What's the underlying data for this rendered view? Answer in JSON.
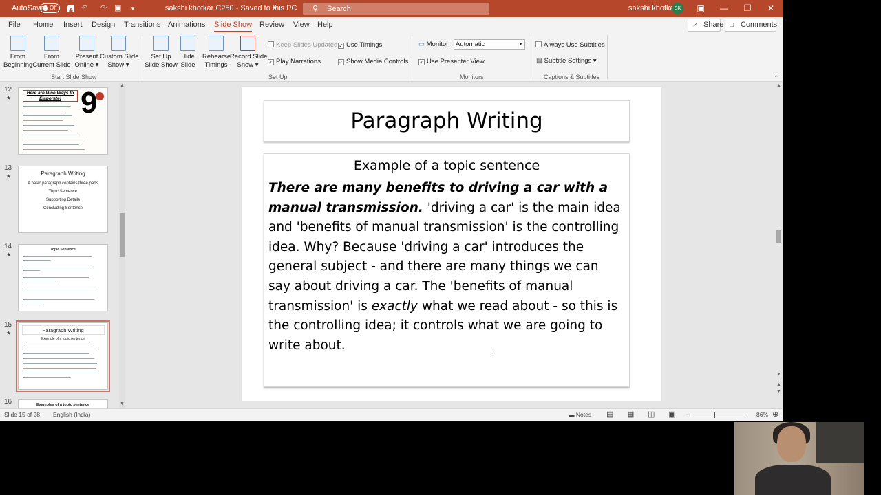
{
  "titlebar": {
    "autosave_label": "AutoSave",
    "autosave_state": "Off",
    "document_title": "sakshi khotkar C250  -  Saved to this PC",
    "search_placeholder": "Search",
    "user_name": "sakshi khotkar",
    "user_initials": "SK"
  },
  "tabs": [
    "File",
    "Home",
    "Insert",
    "Design",
    "Transitions",
    "Animations",
    "Slide Show",
    "Review",
    "View",
    "Help"
  ],
  "active_tab": "Slide Show",
  "share_label": "Share",
  "comments_label": "Comments",
  "ribbon": {
    "from_beginning": [
      "From",
      "Beginning"
    ],
    "from_current": [
      "From",
      "Current Slide"
    ],
    "present_online": [
      "Present",
      "Online"
    ],
    "custom_show": [
      "Custom Slide",
      "Show"
    ],
    "group_start": "Start Slide Show",
    "setup_show": [
      "Set Up",
      "Slide Show"
    ],
    "hide_slide": [
      "Hide",
      "Slide"
    ],
    "rehearse": [
      "Rehearse",
      "Timings"
    ],
    "record": [
      "Record Slide",
      "Show"
    ],
    "keep_slides_updated": "Keep Slides Updated",
    "use_timings": "Use Timings",
    "play_narrations": "Play Narrations",
    "show_media_controls": "Show Media Controls",
    "group_setup": "Set Up",
    "monitor_label": "Monitor:",
    "monitor_value": "Automatic",
    "use_presenter_view": "Use Presenter View",
    "group_monitors": "Monitors",
    "always_use_subtitles": "Always Use Subtitles",
    "subtitle_settings": "Subtitle Settings",
    "group_captions": "Captions & Subtitles"
  },
  "thumbnails": [
    {
      "num": "12",
      "title": "Here are Nine Ways to Elaborate!",
      "big": "9"
    },
    {
      "num": "13",
      "title": "Paragraph Writing",
      "lines": [
        "A basic paragraph contains three parts",
        "Topic Sentence",
        "Supporting Details",
        "Concluding Sentence"
      ]
    },
    {
      "num": "14",
      "title": "Topic Sentence"
    },
    {
      "num": "15",
      "title": "Paragraph Writing",
      "sub": "Example of a topic sentence"
    },
    {
      "num": "16",
      "title": "Examples of a topic sentence"
    }
  ],
  "slide": {
    "title": "Paragraph Writing",
    "heading": "Example of a topic sentence",
    "bold_italic": "There are many benefits to driving a car with a manual transmission.",
    "text_1": "  'driving a car' is the main idea and 'benefits of manual transmission' is the controlling idea. Why? Because 'driving a car' introduces the general subject - and there are many things we can say about driving a car. The 'benefits of manual transmission' is ",
    "italic_word": "exactly",
    "text_2": " what we read about - so this is the controlling idea; it controls what we are going to write about."
  },
  "status": {
    "slide_info": "Slide 15 of 28",
    "language": "English (India)",
    "notes_label": "Notes",
    "zoom": "86%"
  },
  "colors": {
    "accent": "#b7472a",
    "thumb_selection": "#c4756a"
  }
}
